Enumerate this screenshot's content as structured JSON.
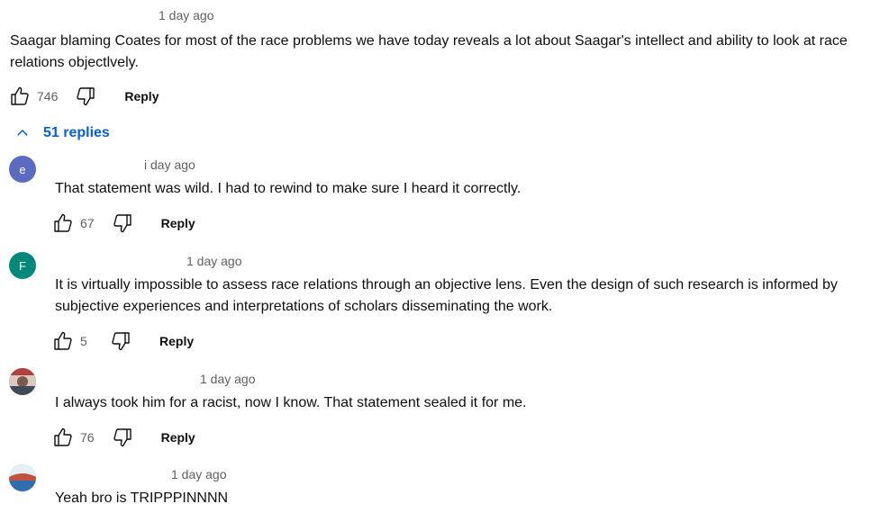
{
  "top_comment": {
    "timestamp": "1 day ago",
    "text": "Saagar blaming Coates for most of the race problems we have today reveals a lot about Saagar's intellect and ability to look at race relations objectlvely.",
    "likes": "746",
    "reply_label": "Reply"
  },
  "replies_toggle": {
    "label": "51 replies"
  },
  "replies": [
    {
      "avatar_letter": "e",
      "avatar_color": "#5c6bc0",
      "timestamp": "i day ago",
      "text": "That statement was wild. I had to rewind to make sure I heard it correctly.",
      "likes": "67",
      "reply_label": "Reply"
    },
    {
      "avatar_letter": "F",
      "avatar_color": "#00897b",
      "timestamp": "1 day ago",
      "text": "It is virtually impossible to assess race relations through an objective lens. Even the design of such research is informed by subjective experiences and interpretations of scholars disseminating the work.",
      "likes": "5",
      "reply_label": "Reply"
    },
    {
      "avatar_letter": "",
      "avatar_color": "#8d6e63",
      "timestamp": "1 day ago",
      "text": "I always took him for a racist, now I know. That statement sealed it for me.",
      "likes": "76",
      "reply_label": "Reply"
    },
    {
      "avatar_letter": "",
      "avatar_color": "#4f7fb3",
      "timestamp": "1 day ago",
      "text": "Yeah bro is TRIPPPINNNN"
    }
  ],
  "icons": {
    "like": "thumbs-up-icon",
    "dislike": "thumbs-down-icon",
    "collapse": "chevron-up-icon"
  },
  "colors": {
    "link_blue": "#065fd4",
    "meta_gray": "#606060"
  }
}
